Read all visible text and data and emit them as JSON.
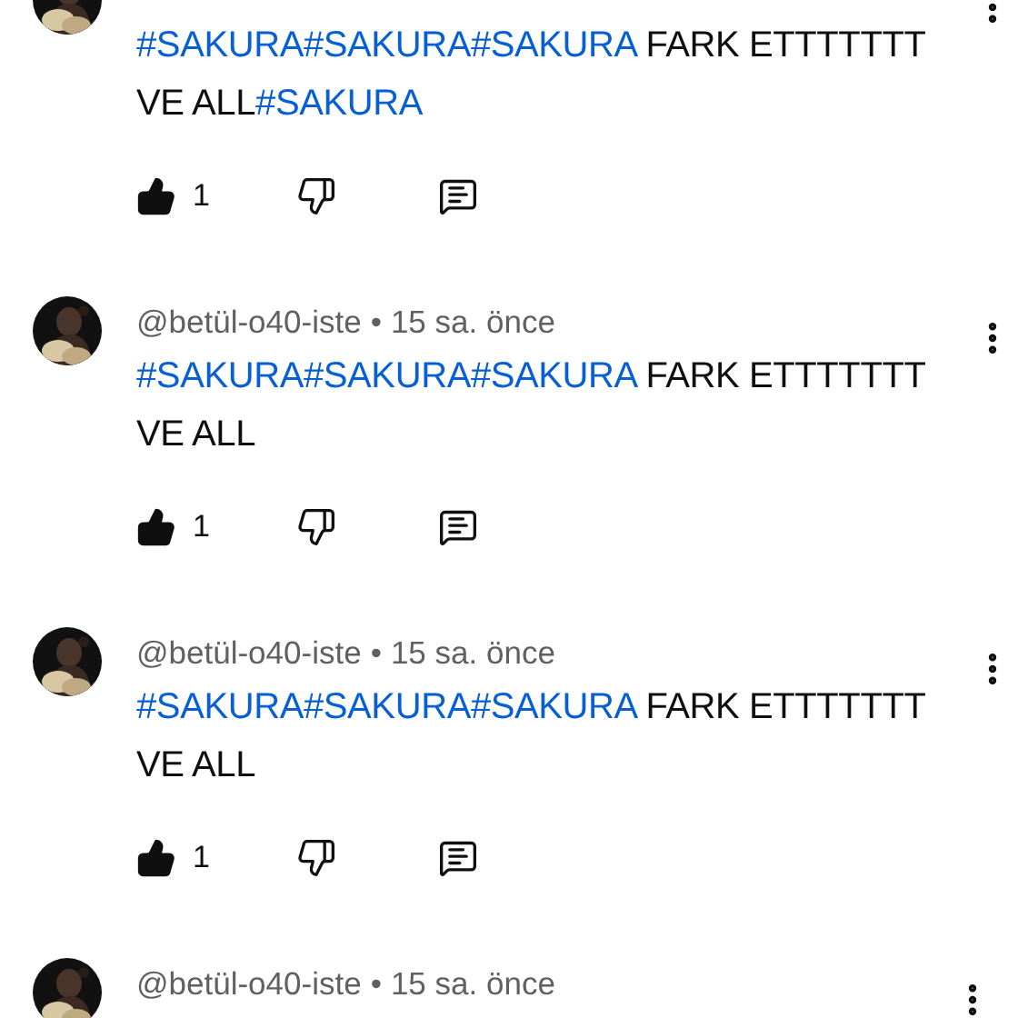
{
  "comments": [
    {
      "body": [
        {
          "kind": "hashtag",
          "text": "#SAKURA"
        },
        {
          "kind": "hashtag",
          "text": "#SAKURA"
        },
        {
          "kind": "hashtag",
          "text": "#SAKURA"
        },
        {
          "kind": "text",
          "text": " FARK ETTTTTTT VE ALL"
        },
        {
          "kind": "hashtag",
          "text": "#SAKURA"
        }
      ],
      "liked": true,
      "likes": "1"
    },
    {
      "author": "@betül-o40-iste",
      "separator": "•",
      "time": "15 sa. önce",
      "body": [
        {
          "kind": "hashtag",
          "text": "#SAKURA"
        },
        {
          "kind": "hashtag",
          "text": "#SAKURA"
        },
        {
          "kind": "hashtag",
          "text": "#SAKURA"
        },
        {
          "kind": "text",
          "text": " FARK ETTTTTTT VE ALL"
        }
      ],
      "liked": true,
      "likes": "1"
    },
    {
      "author": "@betül-o40-iste",
      "separator": "•",
      "time": "15 sa. önce",
      "body": [
        {
          "kind": "hashtag",
          "text": "#SAKURA"
        },
        {
          "kind": "hashtag",
          "text": "#SAKURA"
        },
        {
          "kind": "hashtag",
          "text": "#SAKURA"
        },
        {
          "kind": "text",
          "text": " FARK ETTTTTTT VE ALL"
        }
      ],
      "liked": true,
      "likes": "1"
    },
    {
      "author": "@betül-o40-iste",
      "separator": "•",
      "time": "15 sa. önce"
    }
  ]
}
